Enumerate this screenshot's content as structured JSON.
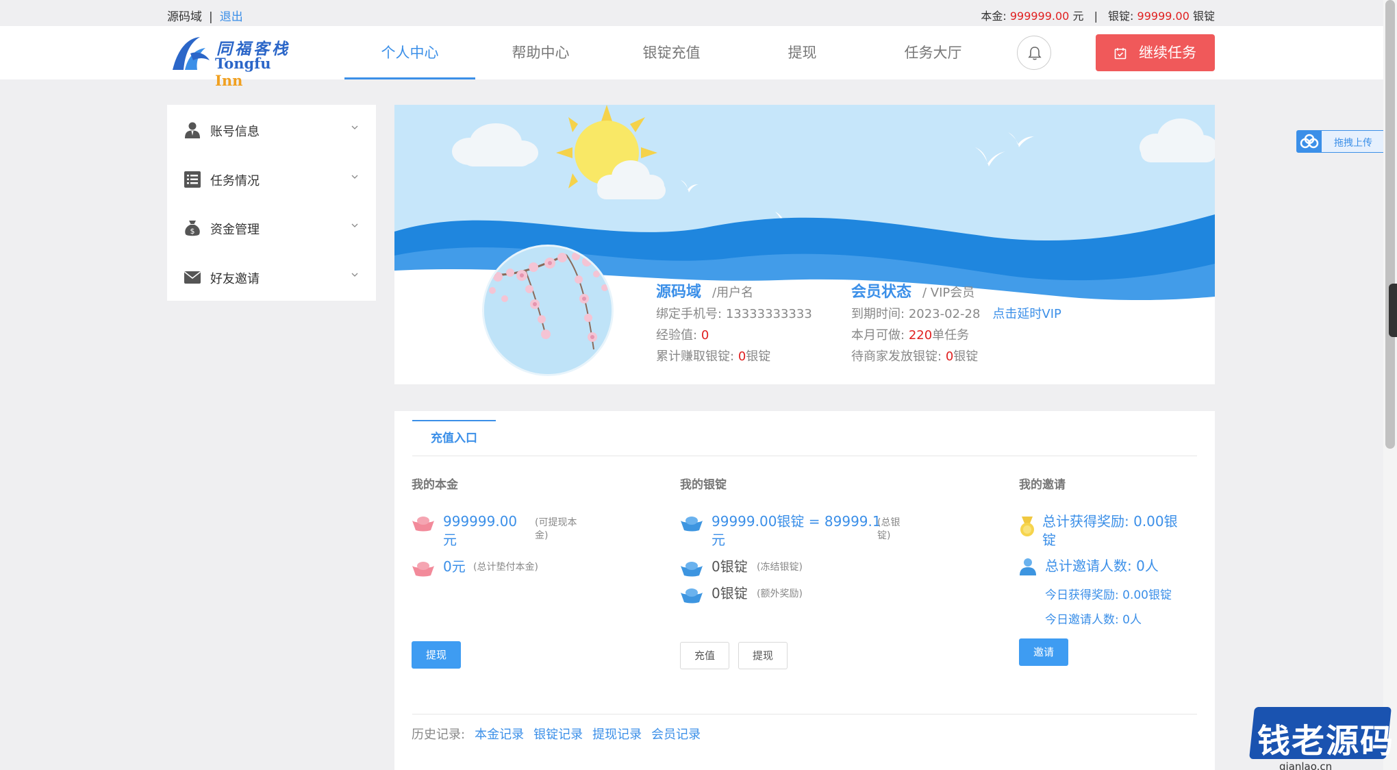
{
  "topbar": {
    "username": "源码域",
    "separator": "|",
    "logout": "退出",
    "principal_label": "本金:",
    "principal_value": "999999.00",
    "principal_unit": "元",
    "ingot_label": "银锭:",
    "ingot_value": "99999.00",
    "ingot_unit": "银锭"
  },
  "logo": {
    "cn": "同福客栈",
    "en_main": "Tongfu ",
    "en_inn": "Inn"
  },
  "nav": {
    "items": [
      "个人中心",
      "帮助中心",
      "银锭充值",
      "提现",
      "任务大厅"
    ],
    "active": 0,
    "continue_label": "继续任务"
  },
  "sidebar": {
    "items": [
      {
        "label": "账号信息",
        "icon": "user-icon"
      },
      {
        "label": "任务情况",
        "icon": "list-icon"
      },
      {
        "label": "资金管理",
        "icon": "money-bag-icon"
      },
      {
        "label": "好友邀请",
        "icon": "envelope-icon"
      }
    ]
  },
  "profile": {
    "name": "源码域",
    "name_suffix": "/用户名",
    "phone_label": "绑定手机号:",
    "phone": "13333333333",
    "exp_label": "经验值:",
    "exp": "0",
    "earned_label": "累计赚取银锭:",
    "earned": "0",
    "earned_unit": "银锭",
    "member_title": "会员状态",
    "member_suffix": "/ VIP会员",
    "expire_label": "到期时间:",
    "expire": "2023-02-28",
    "extend_link": "点击延时VIP",
    "monthly_label": "本月可做:",
    "monthly": "220",
    "monthly_unit": "单任务",
    "pending_label": "待商家发放银锭:",
    "pending": "0",
    "pending_unit": "银锭"
  },
  "panel": {
    "tab": "充值入口",
    "principal": {
      "title": "我的本金",
      "main_value_1": "999999.00",
      "main_value_2": "元",
      "main_note_1": "(可提现本",
      "main_note_2": "金)",
      "second_value": "0元",
      "second_note": "(总计垫付本金)",
      "withdraw": "提现"
    },
    "ingot": {
      "title": "我的银锭",
      "main_value_1": "99999.00银锭 = 89999.1",
      "main_value_2": "元",
      "main_note_1": "(总银",
      "main_note_2": "锭)",
      "frozen_value": "0银锭",
      "frozen_note": "(冻结银锭)",
      "extra_value": "0银锭",
      "extra_note": "(额外奖励)",
      "recharge": "充值",
      "withdraw": "提现"
    },
    "invite": {
      "title": "我的邀请",
      "total_reward_1": "总计获得奖励: 0.00银",
      "total_reward_2": "锭",
      "total_people": "总计邀请人数: 0人",
      "today_reward": "今日获得奖励: 0.00银锭",
      "today_people": "今日邀请人数: 0人",
      "invite": "邀请"
    },
    "history": {
      "label": "历史记录:",
      "links": [
        "本金记录",
        "银锭记录",
        "提现记录",
        "会员记录"
      ]
    }
  },
  "widgets": {
    "upload": "拖拽上传",
    "watermark": "钱老源码",
    "watermark_url": "qianlao.cn"
  },
  "colors": {
    "accent": "#3b8fe8",
    "danger": "#f0595a",
    "red_text": "#e02020",
    "page_bg": "#efeff1"
  }
}
